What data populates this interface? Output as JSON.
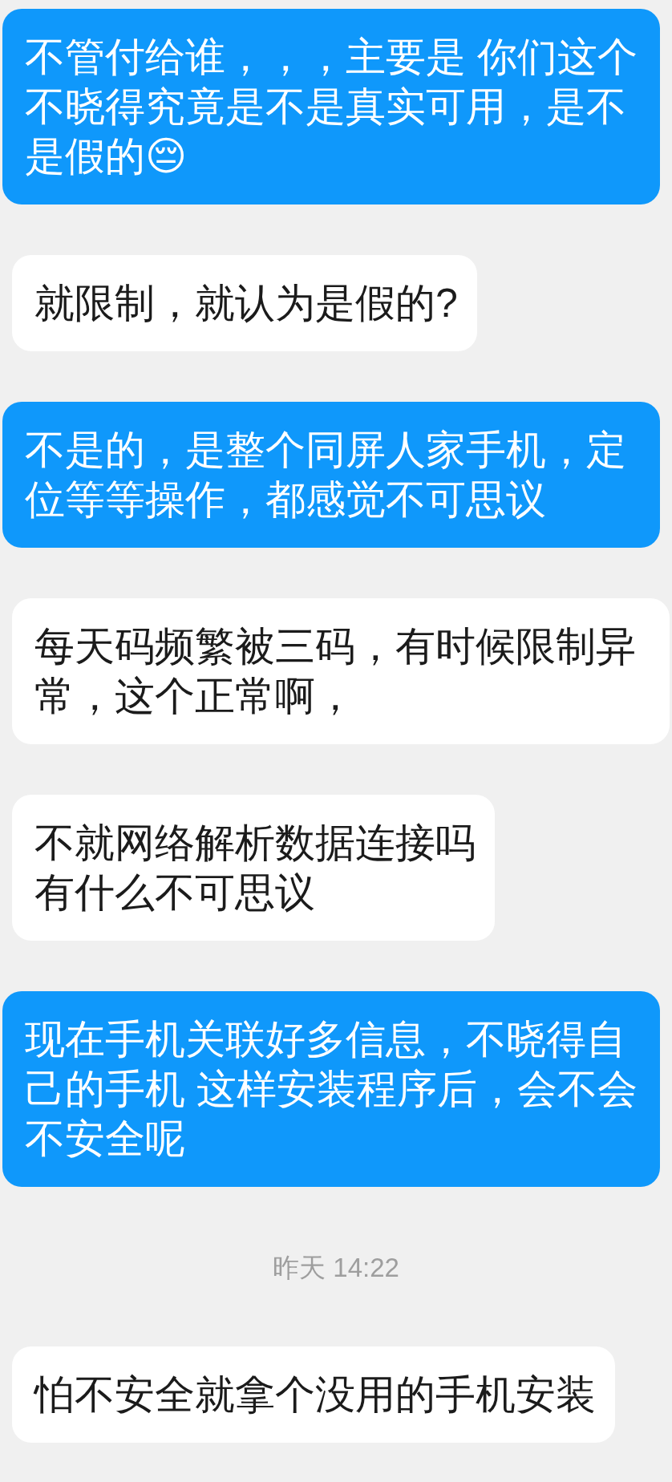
{
  "messages": [
    {
      "kind": "sent",
      "text": "不管付给谁，，，主要是 你们这个不晓得究竟是不是真实可用，是不是假的😔"
    },
    {
      "kind": "received",
      "text": "就限制，就认为是假的?"
    },
    {
      "kind": "sent",
      "text": "不是的，是整个同屏人家手机，定位等等操作，都感觉不可思议"
    },
    {
      "kind": "received",
      "text": "每天码频繁被三码，有时候限制异常，这个正常啊，"
    },
    {
      "kind": "received",
      "lines": [
        "不就网络解析数据连接吗",
        "有什么不可思议"
      ]
    },
    {
      "kind": "sent",
      "text": "现在手机关联好多信息，不晓得自己的手机 这样安装程序后，会不会不安全呢"
    },
    {
      "kind": "timestamp",
      "text": "昨天 14:22"
    },
    {
      "kind": "received",
      "text": "怕不安全就拿个没用的手机安装"
    }
  ]
}
